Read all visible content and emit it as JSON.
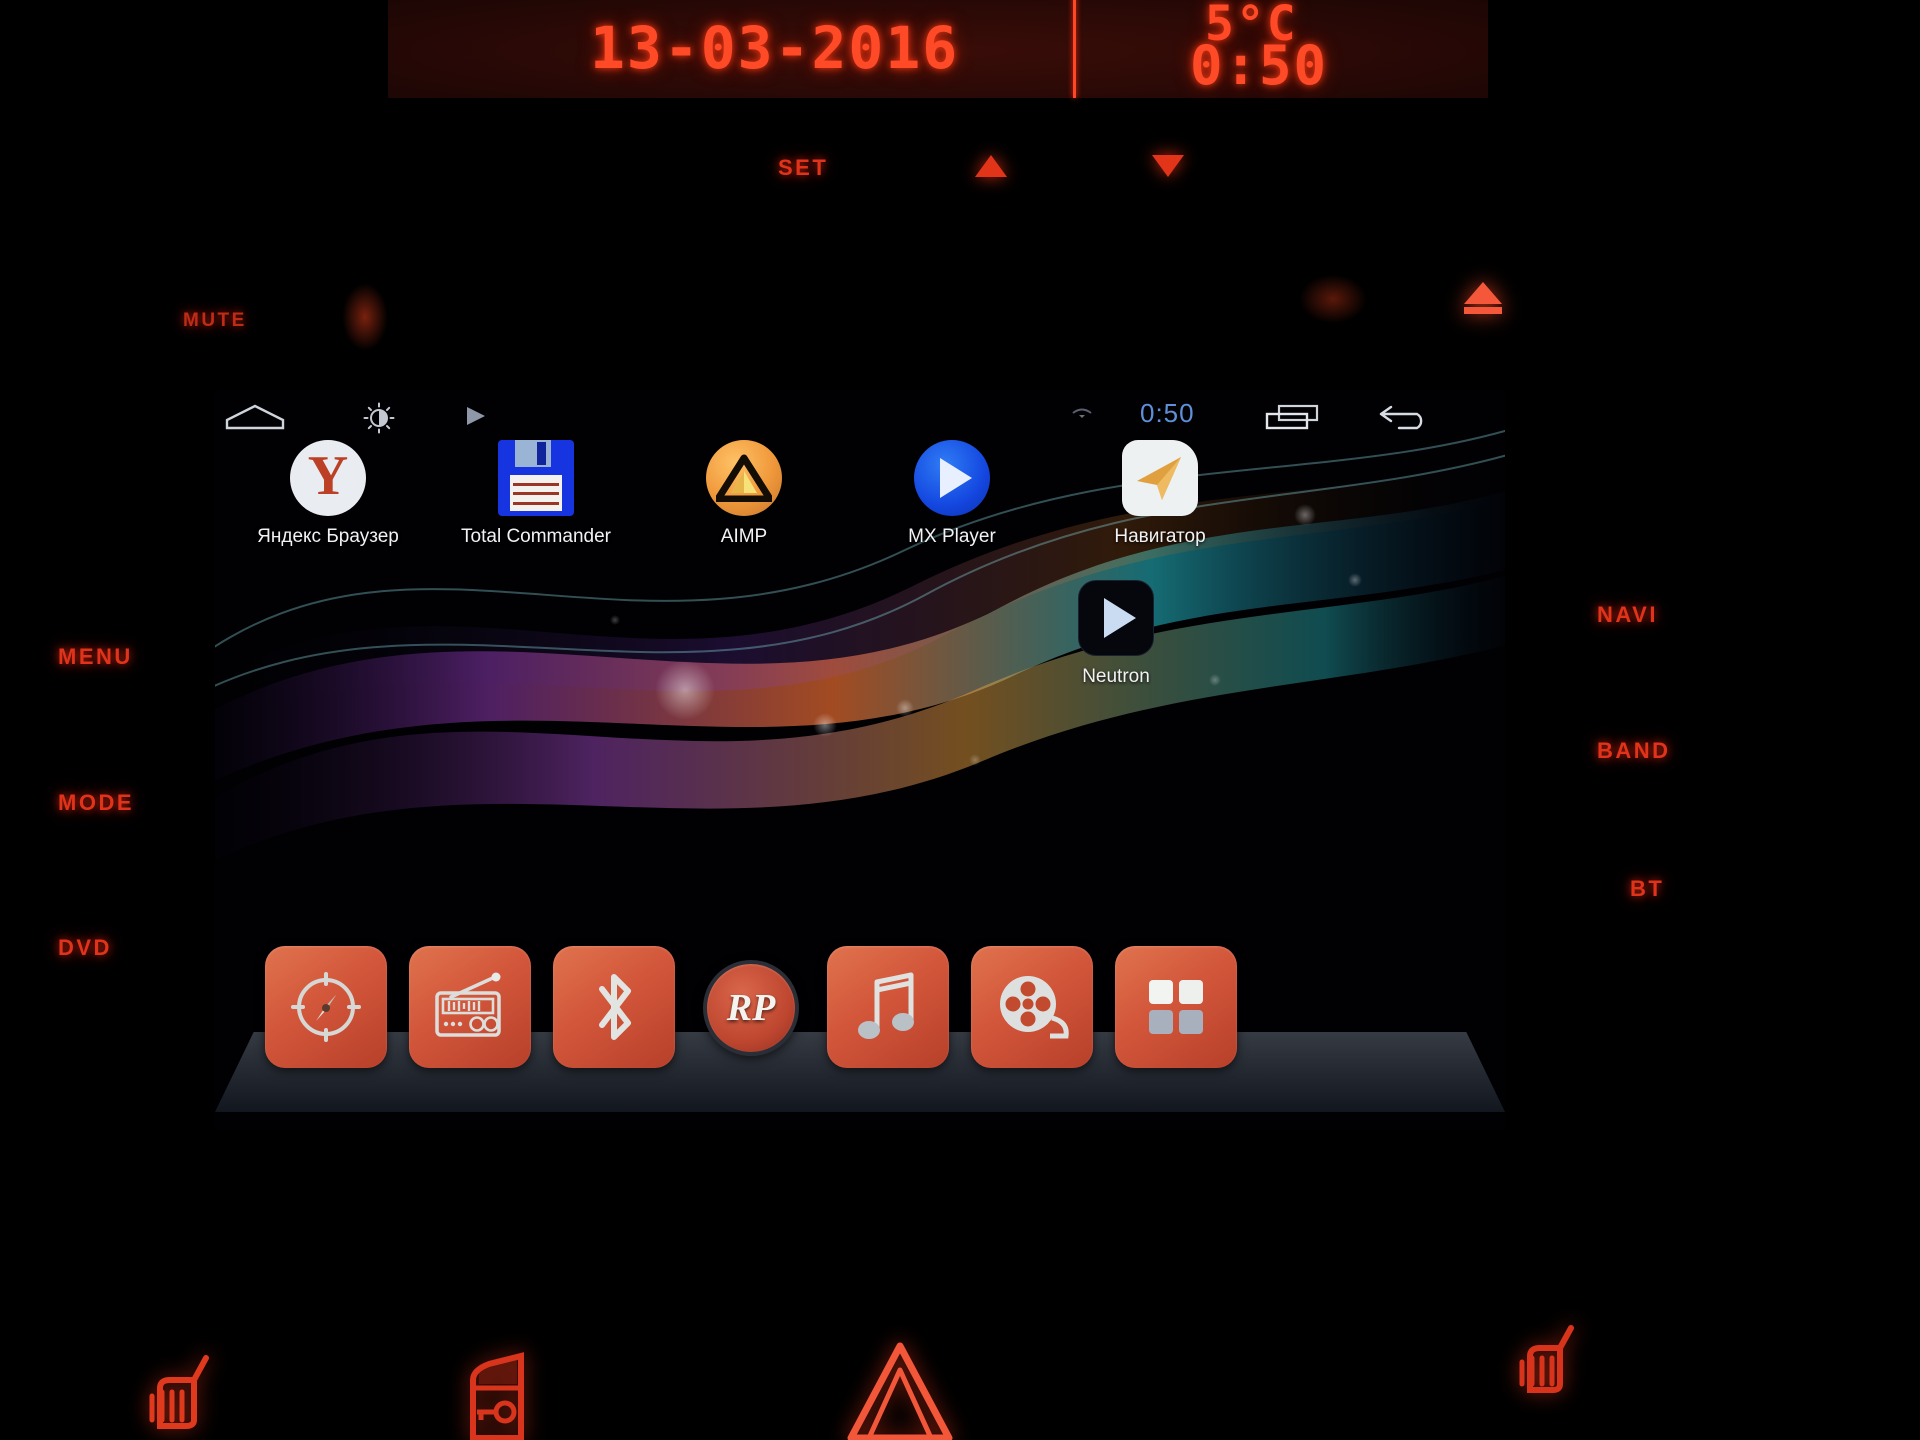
{
  "head_unit": {
    "led_display": {
      "date": "13-03-2016",
      "temperature": "5°C",
      "clock": "0:50"
    },
    "hard_keys": {
      "set": "SET",
      "mute": "MUTE",
      "menu": "MENU",
      "mode": "MODE",
      "dvd": "DVD",
      "navi": "NAVI",
      "band": "BAND",
      "bt": "BT",
      "up_arrow_icon": "triangle-up-icon",
      "down_arrow_icon": "triangle-down-icon",
      "eject_icon": "eject-icon"
    }
  },
  "android": {
    "status_bar": {
      "home_icon": "home-icon",
      "brightness_icon": "brightness-icon",
      "play_icon": "play-icon",
      "signal_text": "",
      "wifi_icon": "wifi-icon",
      "clock": "0:50",
      "recents_icon": "recents-icon",
      "back_icon": "back-icon",
      "clock_color": "#5f8fd8"
    },
    "home_screen": {
      "apps_row_1": [
        {
          "label": "Яндекс Браузер",
          "icon": "yandex-browser-icon",
          "glyph": "Y",
          "color": "#e9ecf0"
        },
        {
          "label": "Total Commander",
          "icon": "total-commander-icon",
          "color": "#1634e0"
        },
        {
          "label": "AIMP",
          "icon": "aimp-icon",
          "color": "#f09a3c"
        },
        {
          "label": "MX Player",
          "icon": "mx-player-icon",
          "color": "#1447e0"
        },
        {
          "label": "Навигатор",
          "icon": "navigator-icon",
          "color": "#eef1f2"
        }
      ],
      "apps_row_2": [
        {
          "label": "Neutron",
          "icon": "neutron-icon",
          "color": "#06070c"
        }
      ]
    },
    "dock": {
      "items": [
        {
          "name": "navigation",
          "icon": "compass-icon"
        },
        {
          "name": "radio",
          "icon": "radio-icon"
        },
        {
          "name": "bluetooth",
          "icon": "bluetooth-icon"
        },
        {
          "name": "app-drawer",
          "icon": "rp-launcher-icon",
          "glyph": "RP"
        },
        {
          "name": "music",
          "icon": "music-note-icon"
        },
        {
          "name": "video",
          "icon": "film-reel-icon"
        },
        {
          "name": "apps",
          "icon": "apps-grid-icon"
        }
      ],
      "accent_color": "#d2563a"
    }
  },
  "dashboard_telltales": [
    {
      "name": "heated-seat-left",
      "icon": "heated-seat-icon",
      "color": "#e03a1e"
    },
    {
      "name": "central-locking",
      "icon": "door-key-icon",
      "color": "#e03a1e"
    },
    {
      "name": "hazard-warning",
      "icon": "hazard-triangle-icon",
      "color": "#f2573a"
    },
    {
      "name": "heated-seat-right",
      "icon": "heated-seat-icon",
      "color": "#d8341c"
    }
  ]
}
